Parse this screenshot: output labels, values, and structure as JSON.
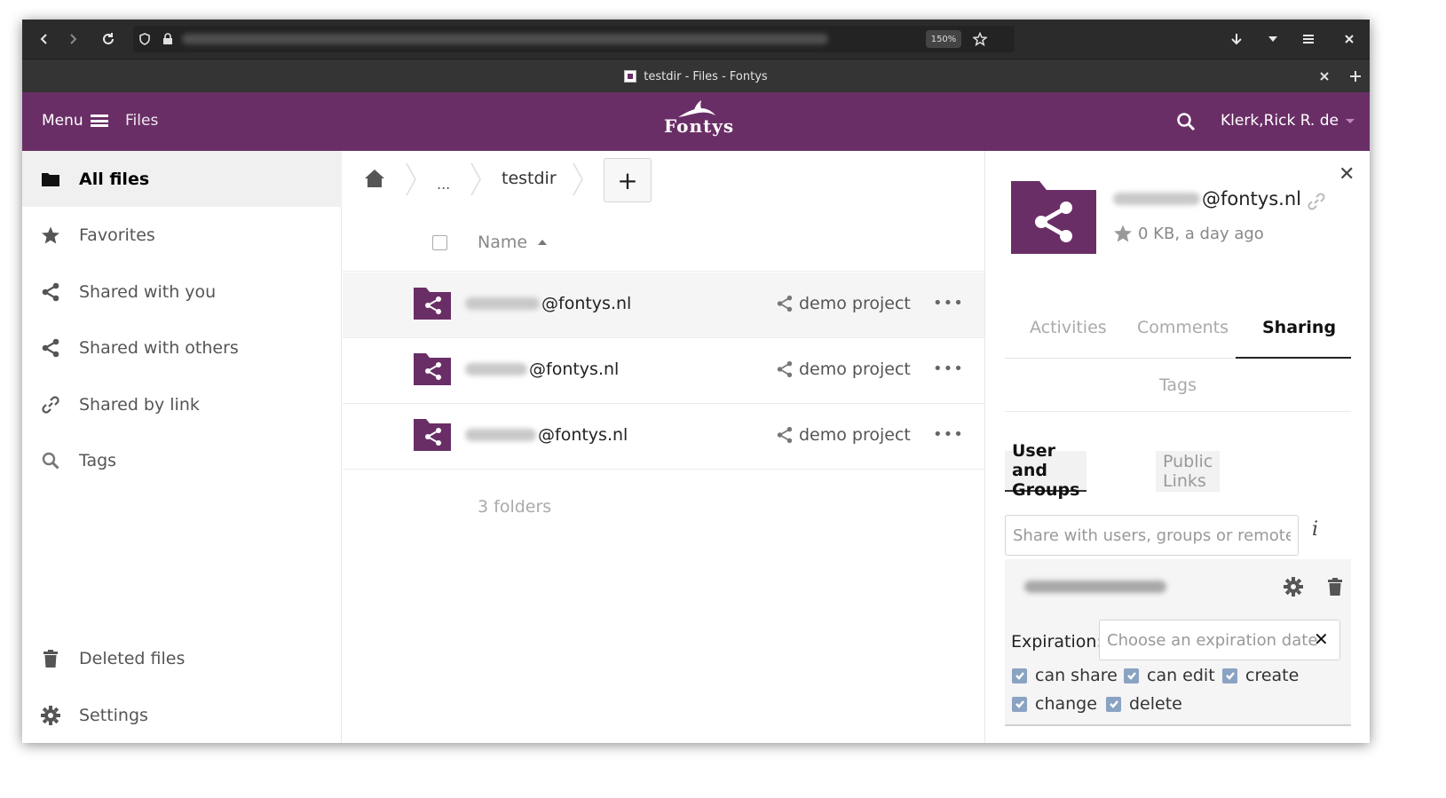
{
  "browser": {
    "zoom": "150%",
    "tab_title": "testdir - Files - Fontys"
  },
  "header": {
    "menu_label": "Menu",
    "files_label": "Files",
    "logo_text": "Fontys",
    "user_name": "Klerk,Rick R. de"
  },
  "nav": {
    "items": [
      {
        "label": "All files",
        "icon": "folder-icon",
        "active": true
      },
      {
        "label": "Favorites",
        "icon": "star-icon"
      },
      {
        "label": "Shared with you",
        "icon": "share-icon"
      },
      {
        "label": "Shared with others",
        "icon": "share-icon"
      },
      {
        "label": "Shared by link",
        "icon": "link-icon"
      },
      {
        "label": "Tags",
        "icon": "search-icon"
      }
    ],
    "deleted_files": "Deleted files",
    "settings": "Settings"
  },
  "main": {
    "breadcrumb_ellipsis": "...",
    "breadcrumb_dir": "testdir",
    "new_button": "+",
    "column_name": "Name",
    "rows": [
      {
        "name_suffix": "@fontys.nl",
        "shared": "demo project",
        "actions": "•••"
      },
      {
        "name_suffix": "@fontys.nl",
        "shared": "demo project",
        "actions": "•••"
      },
      {
        "name_suffix": "@fontys.nl",
        "shared": "demo project",
        "actions": "•••"
      }
    ],
    "summary": "3 folders"
  },
  "sidebar": {
    "title_suffix": "@fontys.nl",
    "meta": "0 KB, a day ago",
    "tabs": [
      "Activities",
      "Comments",
      "Sharing"
    ],
    "tags_tab": "Tags",
    "subtabs": [
      "User and Groups",
      "Public Links"
    ],
    "share_placeholder": "Share with users, groups or remote u",
    "info_glyph": "i",
    "expiration_label": "Expiration:",
    "expiration_placeholder": "Choose an expiration date",
    "clear_glyph": "✕",
    "close_glyph": "✕",
    "permissions": [
      {
        "label": "can share",
        "checked": true
      },
      {
        "label": "can edit",
        "checked": true
      },
      {
        "label": "create",
        "checked": true
      },
      {
        "label": "change",
        "checked": true
      },
      {
        "label": "delete",
        "checked": true
      }
    ]
  },
  "colors": {
    "brand": "#6a2e66",
    "chrome": "#2b2b2b",
    "checkbox": "#8aa3c2"
  }
}
